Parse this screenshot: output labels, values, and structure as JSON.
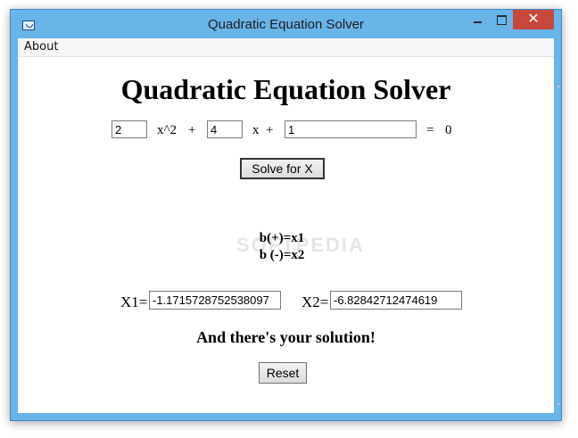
{
  "window": {
    "title": "Quadratic Equation Solver",
    "close_glyph": "✕"
  },
  "menu": {
    "about": "About"
  },
  "main": {
    "heading": "Quadratic Equation Solver",
    "equation": {
      "a_value": "2",
      "x_squared_label": "x^2",
      "plus1": "+",
      "b_value": "4",
      "x_label": "x",
      "plus2": "+",
      "c_value": "1",
      "equals": "=",
      "zero": "0"
    },
    "solve_button": "Solve for X",
    "watermark": "SOFTPEDIA",
    "notes": {
      "line1": "b(+)=x1",
      "line2": "b (-)=x2"
    },
    "results": {
      "x1_label": "X1=",
      "x1_value": "-1.1715728752538097",
      "x2_label": "X2=",
      "x2_value": "-6.82842712474619"
    },
    "solution_text": "And there's your solution!",
    "reset_button": "Reset"
  }
}
